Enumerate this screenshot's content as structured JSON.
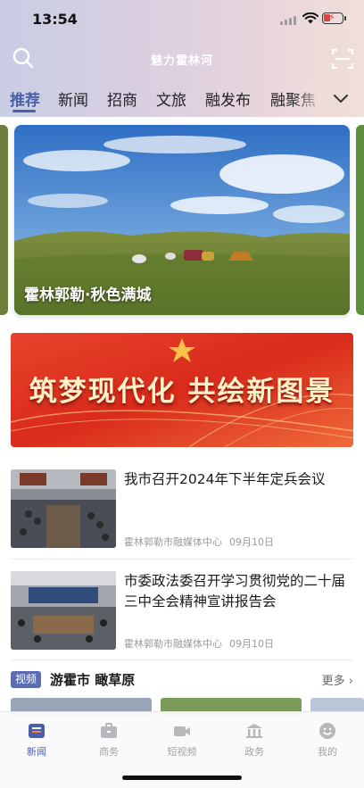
{
  "status": {
    "time": "13:54"
  },
  "header": {
    "title": "魅力霍林河"
  },
  "tabs": [
    {
      "label": "推荐",
      "active": true
    },
    {
      "label": "新闻"
    },
    {
      "label": "招商"
    },
    {
      "label": "文旅"
    },
    {
      "label": "融发布"
    },
    {
      "label": "融聚焦"
    }
  ],
  "hero": {
    "caption": "霍林郭勒·秋色满城"
  },
  "banner": {
    "text": "筑梦现代化 共绘新图景"
  },
  "news": [
    {
      "title": "我市召开2024年下半年定兵会议",
      "source": "霍林郭勒市融媒体中心",
      "date": "09月10日"
    },
    {
      "title": "市委政法委召开学习贯彻党的二十届三中全会精神宣讲报告会",
      "source": "霍林郭勒市融媒体中心",
      "date": "09月10日"
    }
  ],
  "video_section": {
    "badge": "视频",
    "title": "游霍市 瞰草原",
    "more": "更多"
  },
  "tabbar": [
    {
      "label": "新闻",
      "icon": "news-icon",
      "active": true
    },
    {
      "label": "商务",
      "icon": "briefcase-icon"
    },
    {
      "label": "短视频",
      "icon": "video-camera-icon"
    },
    {
      "label": "政务",
      "icon": "government-building-icon"
    },
    {
      "label": "我的",
      "icon": "smiley-face-icon"
    }
  ],
  "colors": {
    "accent": "#4a5fa8",
    "banner_red": "#d9301f"
  }
}
